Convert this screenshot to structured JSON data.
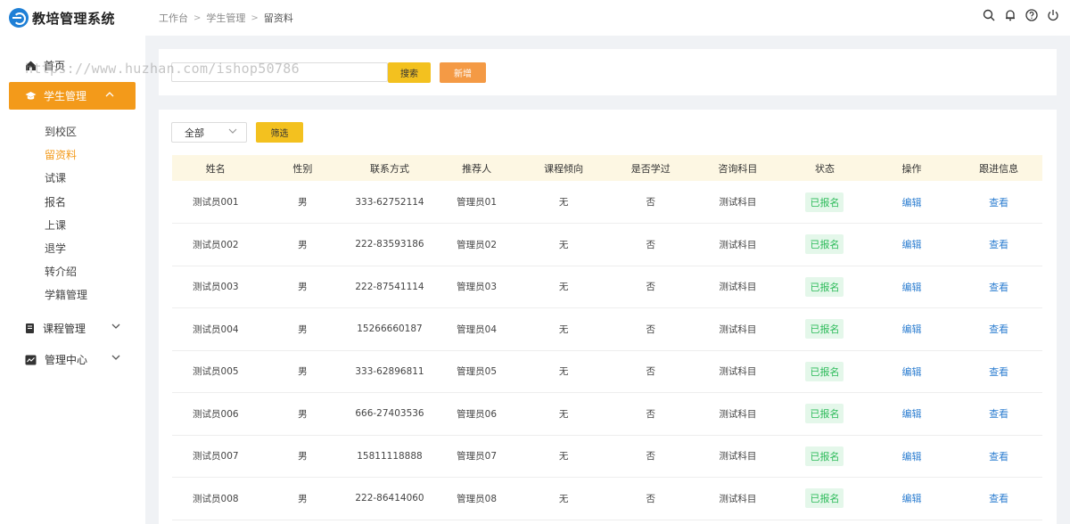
{
  "app": {
    "title": "教培管理系统"
  },
  "breadcrumb": [
    "工作台",
    "学生管理",
    "留资料"
  ],
  "header_icons": [
    "search-icon",
    "bell-icon",
    "help-icon",
    "power-icon"
  ],
  "sidebar": {
    "home": "首页",
    "active_group": "学生管理",
    "sub_items": [
      "到校区",
      "留资料",
      "试课",
      "报名",
      "上课",
      "退学",
      "转介绍",
      "学籍管理"
    ],
    "active_sub": "留资料",
    "groups": [
      "课程管理",
      "管理中心"
    ]
  },
  "toolbar": {
    "search_placeholder": "",
    "search_label": "搜索",
    "add_label": "新增"
  },
  "filter": {
    "select_value": "全部",
    "filter_label": "筛选"
  },
  "table": {
    "headers": [
      "姓名",
      "性别",
      "联系方式",
      "推荐人",
      "课程倾向",
      "是否学过",
      "咨询科目",
      "状态",
      "操作",
      "跟进信息"
    ],
    "rows": [
      {
        "name": "测试员001",
        "gender": "男",
        "phone": "333-62752114",
        "referrer": "管理员01",
        "tendency": "无",
        "learned": "否",
        "subject": "测试科目",
        "status": "已报名",
        "action": "编辑",
        "follow": "查看"
      },
      {
        "name": "测试员002",
        "gender": "男",
        "phone": "222-83593186",
        "referrer": "管理员02",
        "tendency": "无",
        "learned": "否",
        "subject": "测试科目",
        "status": "已报名",
        "action": "编辑",
        "follow": "查看"
      },
      {
        "name": "测试员003",
        "gender": "男",
        "phone": "222-87541114",
        "referrer": "管理员03",
        "tendency": "无",
        "learned": "否",
        "subject": "测试科目",
        "status": "已报名",
        "action": "编辑",
        "follow": "查看"
      },
      {
        "name": "测试员004",
        "gender": "男",
        "phone": "15266660187",
        "referrer": "管理员04",
        "tendency": "无",
        "learned": "否",
        "subject": "测试科目",
        "status": "已报名",
        "action": "编辑",
        "follow": "查看"
      },
      {
        "name": "测试员005",
        "gender": "男",
        "phone": "333-62896811",
        "referrer": "管理员05",
        "tendency": "无",
        "learned": "否",
        "subject": "测试科目",
        "status": "已报名",
        "action": "编辑",
        "follow": "查看"
      },
      {
        "name": "测试员006",
        "gender": "男",
        "phone": "666-27403536",
        "referrer": "管理员06",
        "tendency": "无",
        "learned": "否",
        "subject": "测试科目",
        "status": "已报名",
        "action": "编辑",
        "follow": "查看"
      },
      {
        "name": "测试员007",
        "gender": "男",
        "phone": "15811118888",
        "referrer": "管理员07",
        "tendency": "无",
        "learned": "否",
        "subject": "测试科目",
        "status": "已报名",
        "action": "编辑",
        "follow": "查看"
      },
      {
        "name": "测试员008",
        "gender": "男",
        "phone": "222-86414060",
        "referrer": "管理员08",
        "tendency": "无",
        "learned": "否",
        "subject": "测试科目",
        "status": "已报名",
        "action": "编辑",
        "follow": "查看"
      }
    ]
  },
  "watermark": "https://www.huzhan.com/ishop50786",
  "colors": {
    "accent": "#f39a1a",
    "search_button": "#f3c11f",
    "add_button": "#f49a45",
    "status_green": "#2dbb5a",
    "link_blue": "#2f7fd1",
    "header_row": "#fdf7e3"
  }
}
